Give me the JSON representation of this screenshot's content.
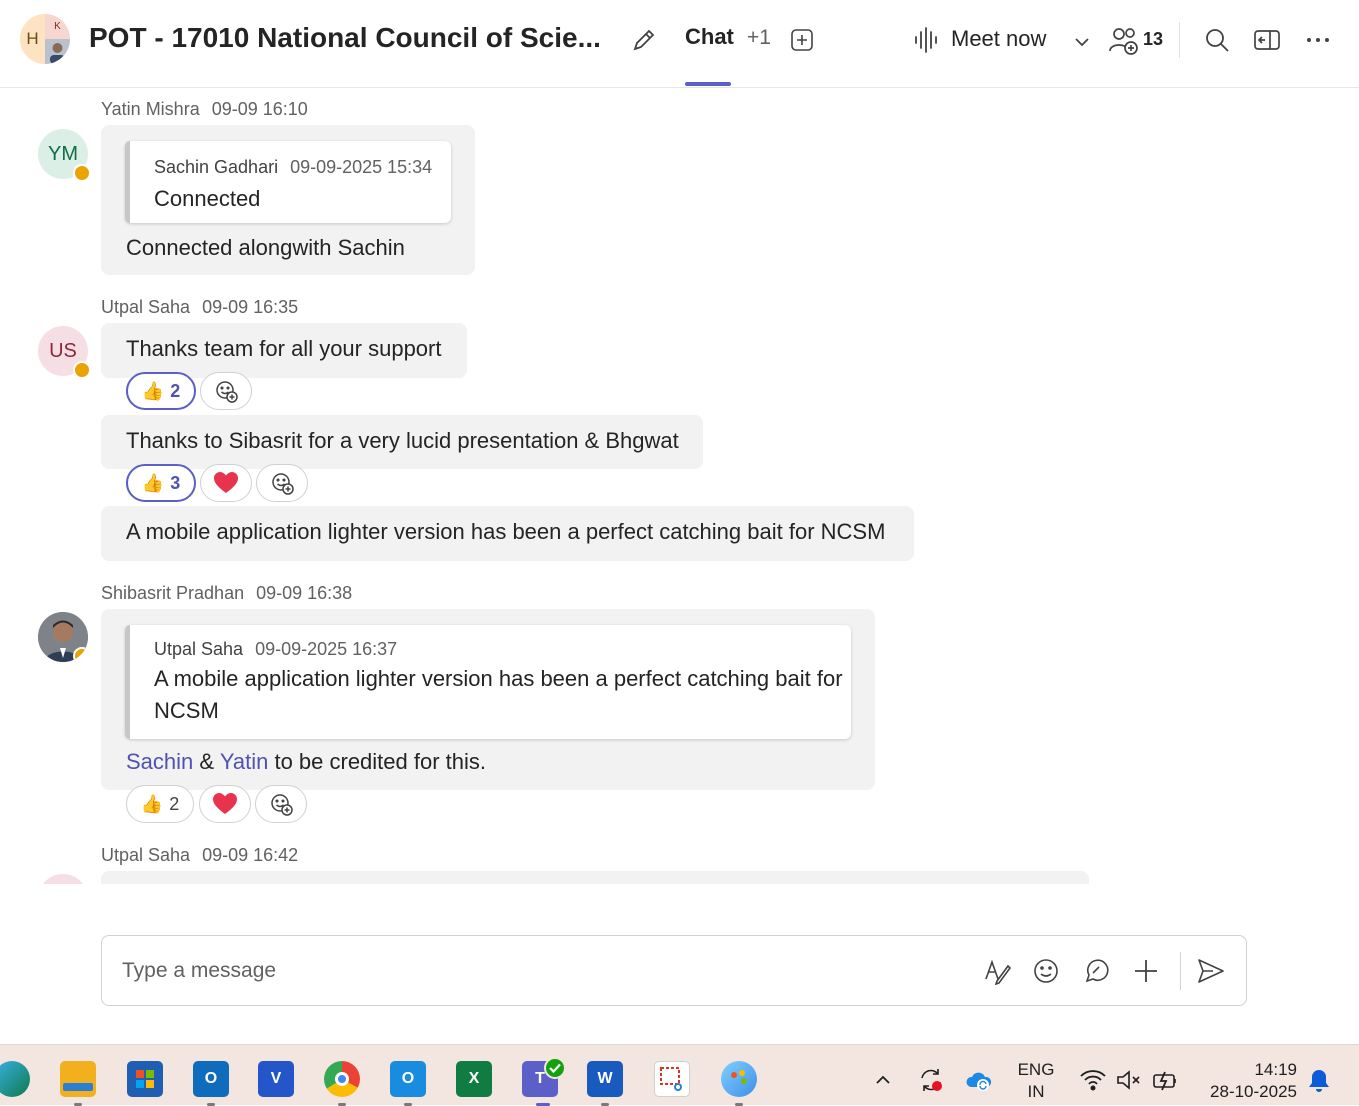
{
  "header": {
    "group_avatar_letters": {
      "h": "H",
      "k": "K"
    },
    "title": "POT - 17010 National Council of Scie...",
    "tabs": {
      "chat": "Chat",
      "more": "+1"
    },
    "meet_now": "Meet now",
    "participants_count": "13"
  },
  "messages": [
    {
      "author": "Yatin Mishra",
      "time": "09-09 16:10",
      "initials": "YM",
      "quote": {
        "author": "Sachin Gadhari",
        "time": "09-09-2025 15:34",
        "text": "Connected"
      },
      "text": "Connected alongwith Sachin"
    },
    {
      "author": "Utpal Saha",
      "time": "09-09 16:35",
      "initials": "US",
      "items": [
        {
          "text": "Thanks team for all your support",
          "like_count": "2"
        },
        {
          "text": "Thanks to Sibasrit for a very lucid presentation & Bhgwat",
          "like_count": "3"
        },
        {
          "text": "A mobile application lighter version has been a perfect catching bait for NCSM"
        }
      ]
    },
    {
      "author": "Shibasrit Pradhan",
      "time": "09-09 16:38",
      "quote": {
        "author": "Utpal Saha",
        "time": "09-09-2025 16:37",
        "text": "A mobile application lighter version has been a perfect catching bait for NCSM"
      },
      "mention_1": "Sachin",
      "amp": "&",
      "mention_2": "Yatin",
      "text_rest": "to be credited for this.",
      "like_count": "2"
    },
    {
      "author": "Utpal Saha",
      "time": "09-09 16:42"
    }
  ],
  "compose": {
    "placeholder": "Type a message"
  },
  "taskbar": {
    "language": {
      "line1": "ENG",
      "line2": "IN"
    },
    "time": "14:19",
    "date": "28-10-2025",
    "apps": [
      "edge-icon",
      "file-explorer-icon",
      "store-icon",
      "outlook-icon",
      "viva-icon",
      "chrome-icon",
      "outlook-new-icon",
      "excel-icon",
      "teams-icon",
      "word-icon",
      "snipping-tool-icon",
      "paint-icon"
    ]
  },
  "colors": {
    "accent": "#5b5fc7",
    "bubble": "#f2f2f2",
    "away": "#eaa300",
    "heart": "#e8334f"
  }
}
